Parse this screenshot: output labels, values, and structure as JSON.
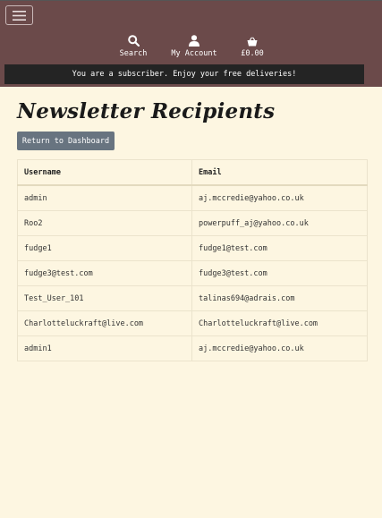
{
  "header": {
    "nav": {
      "search_label": "Search",
      "account_label": "My Account",
      "bag_total": "£0.00"
    },
    "banner": "You are a subscriber. Enjoy your free deliveries!"
  },
  "main": {
    "title": "Newsletter Recipients",
    "dashboard_button": "Return to Dashboard",
    "table": {
      "headers": [
        "Username",
        "Email"
      ],
      "rows": [
        [
          "admin",
          "aj.mccredie@yahoo.co.uk"
        ],
        [
          "Roo2",
          "powerpuff_aj@yahoo.co.uk"
        ],
        [
          "fudge1",
          "fudge1@test.com"
        ],
        [
          "fudge3@test.com",
          "fudge3@test.com"
        ],
        [
          "Test_User_101",
          "talinas694@adrais.com"
        ],
        [
          "Charlotteluckraft@live.com",
          "Charlotteluckraft@live.com"
        ],
        [
          "admin1",
          "aj.mccredie@yahoo.co.uk"
        ]
      ]
    }
  },
  "colors": {
    "header_bg": "#6b4a4a",
    "banner_bg": "#242424",
    "page_bg": "#fdf6e1",
    "button_bg": "#687480"
  },
  "icons": {
    "menu": "hamburger-icon",
    "search": "search-icon",
    "account": "user-icon",
    "bag": "shopping-basket-icon"
  }
}
